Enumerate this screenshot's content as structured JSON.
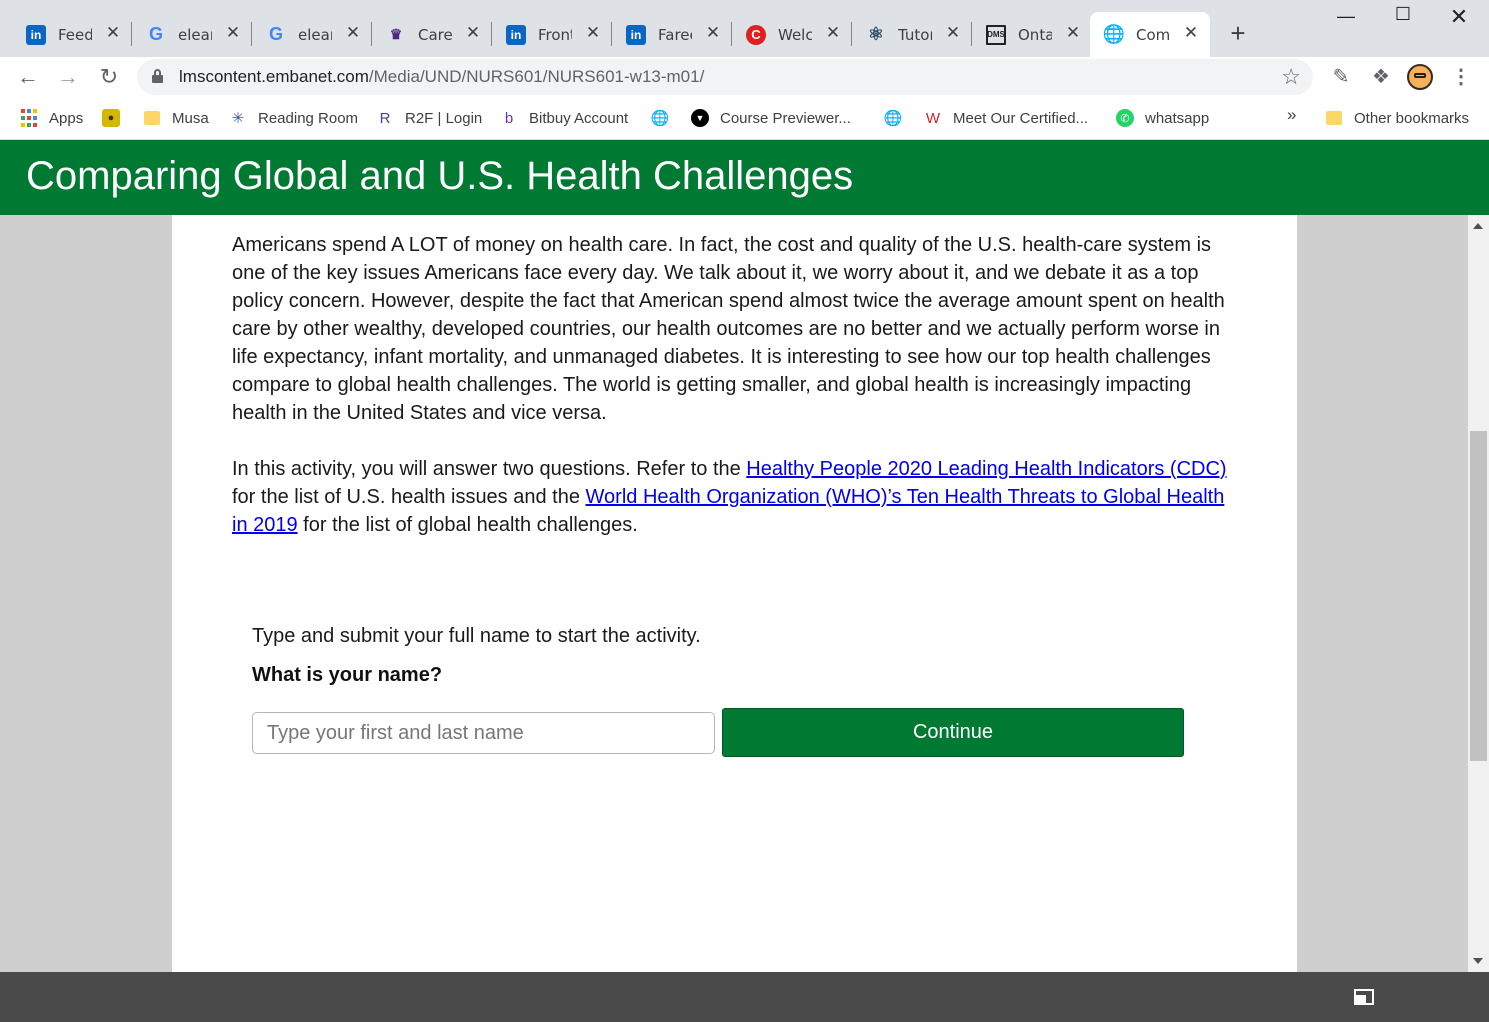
{
  "tabs": [
    {
      "title": "Feed | LinkedIn",
      "icon": "linkedin-icon",
      "glyph": "in",
      "cls": "fav-li"
    },
    {
      "title": "elearning",
      "icon": "google-icon",
      "glyph": "G",
      "cls": "fav-g"
    },
    {
      "title": "elearning",
      "icon": "google-icon",
      "glyph": "G",
      "cls": "fav-g"
    },
    {
      "title": "Careers",
      "icon": "university-crest-icon",
      "glyph": "♛",
      "cls": "fav-w"
    },
    {
      "title": "Frontend",
      "icon": "linkedin-icon",
      "glyph": "in",
      "cls": "fav-li"
    },
    {
      "title": "Fareed",
      "icon": "linkedin-icon",
      "glyph": "in",
      "cls": "fav-li"
    },
    {
      "title": "Welcome",
      "icon": "c-logo-icon",
      "glyph": "C",
      "cls": "fav-c"
    },
    {
      "title": "Tutorial",
      "icon": "react-icon",
      "glyph": "⚛",
      "cls": "fav-r"
    },
    {
      "title": "Ontario",
      "icon": "dms-icon",
      "glyph": "DMS",
      "cls": "fav-d"
    },
    {
      "title": "Comparing",
      "icon": "globe-icon",
      "glyph": "🌐",
      "cls": "fav-globe",
      "active": true
    }
  ],
  "toolbar": {
    "url_host": "lmscontent.embanet.com",
    "url_path": "/Media/UND/NURS601/NURS601-w13-m01/"
  },
  "bookmarks": [
    {
      "label": "Apps",
      "icon": "apps-grid-icon"
    },
    {
      "label": "",
      "icon": "turtle-icon"
    },
    {
      "label": "Musa",
      "icon": "folder-icon"
    },
    {
      "label": "Reading Room",
      "icon": "sparkle-icon"
    },
    {
      "label": "R2F | Login",
      "icon": "r2f-icon"
    },
    {
      "label": "Bitbuy Account",
      "icon": "bitbuy-icon"
    },
    {
      "label": "",
      "icon": "globe-icon"
    },
    {
      "label": "Course Previewer...",
      "icon": "triangle-logo-icon"
    },
    {
      "label": "",
      "icon": "globe-icon"
    },
    {
      "label": "Meet Our Certified...",
      "icon": "w-logo-icon"
    },
    {
      "label": "whatsapp",
      "icon": "whatsapp-icon"
    }
  ],
  "bookmarks_more": "»",
  "other_bookmarks": "Other bookmarks",
  "page": {
    "title": "Comparing Global and U.S. Health Challenges",
    "intro": "Americans spend A LOT of money on health care. In fact, the cost and quality of the U.S. health-care system is one of the key issues Americans face every day. We talk about it, we worry about it, and we debate it as a top policy concern. However, despite the fact that American spend almost twice the average amount spent on health care by other wealthy, developed countries, our health outcomes are no better and we actually perform worse in life expectancy, infant mortality, and unmanaged diabetes. It is interesting to see how our top health challenges compare to global health challenges. The world is getting smaller, and global health is increasingly impacting health in the United States and vice versa.",
    "activity_p1": "In this activity, you will answer two questions. Refer to the ",
    "link_cdc": "Healthy People 2020 Leading Health Indicators (CDC)",
    "activity_p2": " for the list of U.S. health issues and the ",
    "link_who": "World Health Organization (WHO)’s Ten Health Threats to Global Health in 2019",
    "activity_p3": " for the list of global health challenges.",
    "prompt": "Type and submit your full name to start the activity.",
    "question": "What is your name?",
    "name_placeholder": "Type your first and last name",
    "continue_label": "Continue"
  },
  "colors": {
    "brand_green": "#007a33",
    "link_blue": "#0000ee"
  }
}
